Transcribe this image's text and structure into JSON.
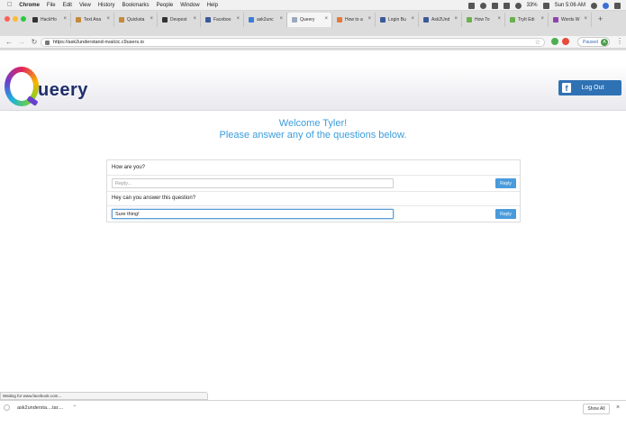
{
  "menubar": {
    "app": "Chrome",
    "items": [
      "File",
      "Edit",
      "View",
      "History",
      "Bookmarks",
      "People",
      "Window",
      "Help"
    ],
    "battery": "33%",
    "clock": "Sun 5:06 AM"
  },
  "tabs": [
    {
      "label": "HackHo",
      "color": "#333333"
    },
    {
      "label": "Text Ana",
      "color": "#c48a3b"
    },
    {
      "label": "Quicksta",
      "color": "#c48a3b"
    },
    {
      "label": "Devpost",
      "color": "#333333"
    },
    {
      "label": "Faceboo",
      "color": "#3b5998"
    },
    {
      "label": "ask2unc",
      "color": "#3b7dd8"
    },
    {
      "label": "Queery",
      "color": "#9ab",
      "active": true
    },
    {
      "label": "How to a",
      "color": "#e07b39"
    },
    {
      "label": "Login Bu",
      "color": "#3b5998"
    },
    {
      "label": "Ask2Und",
      "color": "#3b5998"
    },
    {
      "label": "How To",
      "color": "#6ab04c"
    },
    {
      "label": "TryIt Edi",
      "color": "#6ab04c"
    },
    {
      "label": "Words W",
      "color": "#8e44ad"
    }
  ],
  "toolbar": {
    "url": "https://ask2understand-nvalcic.c9users.io",
    "profile_status": "Paused",
    "profile_initial": "A"
  },
  "header": {
    "logo_text": "ueery",
    "logout_label": "Log Out"
  },
  "main": {
    "welcome_line1": "Welcome Tyler!",
    "welcome_line2": "Please answer any of the questions below.",
    "questions": [
      {
        "question": "How are you?",
        "reply_value": "",
        "reply_placeholder": "Reply...",
        "button": "Reply"
      },
      {
        "question": "Hey can you answer this question?",
        "reply_value": "Sure thing!",
        "reply_placeholder": "Reply...",
        "button": "Reply"
      }
    ]
  },
  "status": {
    "text": "Waiting for www.facebook.com..."
  },
  "downloads": {
    "filename": "ask2understa....tar....",
    "show_all": "Show All"
  },
  "colors": {
    "accent": "#3b9ddc",
    "logout_bg": "#2f72b4",
    "reply_bg": "#4a9bdc"
  }
}
